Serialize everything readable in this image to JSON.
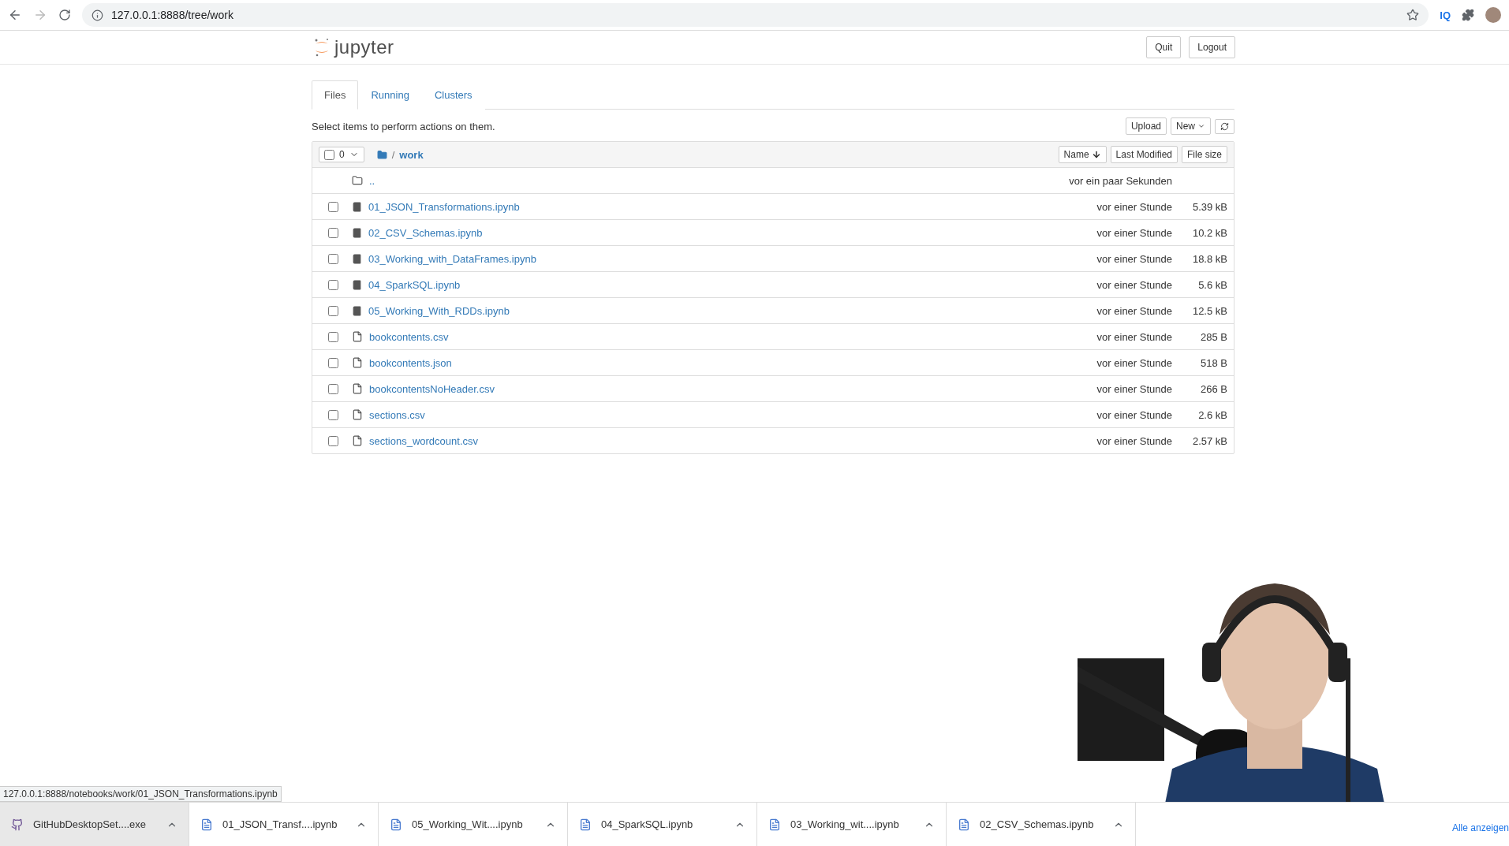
{
  "browser": {
    "url": "127.0.0.1:8888/tree/work",
    "extension": "IQ"
  },
  "header": {
    "logo_text": "jupyter",
    "buttons": [
      "Quit",
      "Logout"
    ]
  },
  "tabs": [
    {
      "label": "Files",
      "selected": true
    },
    {
      "label": "Running",
      "selected": false
    },
    {
      "label": "Clusters",
      "selected": false
    }
  ],
  "toolbar": {
    "hint": "Select items to perform actions on them.",
    "upload": "Upload",
    "new": "New"
  },
  "list_header": {
    "all_checked": false,
    "count": "0",
    "separator": "/",
    "folder": "work",
    "sort_buttons": [
      {
        "label": "Name",
        "sorted": true
      },
      {
        "label": "Last Modified",
        "sorted": false
      },
      {
        "label": "File size",
        "sorted": false
      }
    ]
  },
  "parent_row": {
    "name": "..",
    "modified": "vor ein paar Sekunden"
  },
  "rows": [
    {
      "kind": "notebook",
      "name": "01_JSON_Transformations.ipynb",
      "modified": "vor einer Stunde",
      "size": "5.39 kB",
      "checked": false
    },
    {
      "kind": "notebook",
      "name": "02_CSV_Schemas.ipynb",
      "modified": "vor einer Stunde",
      "size": "10.2 kB",
      "checked": false
    },
    {
      "kind": "notebook",
      "name": "03_Working_with_DataFrames.ipynb",
      "modified": "vor einer Stunde",
      "size": "18.8 kB",
      "checked": false
    },
    {
      "kind": "notebook",
      "name": "04_SparkSQL.ipynb",
      "modified": "vor einer Stunde",
      "size": "5.6 kB",
      "checked": false
    },
    {
      "kind": "notebook",
      "name": "05_Working_With_RDDs.ipynb",
      "modified": "vor einer Stunde",
      "size": "12.5 kB",
      "checked": false
    },
    {
      "kind": "file",
      "name": "bookcontents.csv",
      "modified": "vor einer Stunde",
      "size": "285 B",
      "checked": false
    },
    {
      "kind": "file",
      "name": "bookcontents.json",
      "modified": "vor einer Stunde",
      "size": "518 B",
      "checked": false
    },
    {
      "kind": "file",
      "name": "bookcontentsNoHeader.csv",
      "modified": "vor einer Stunde",
      "size": "266 B",
      "checked": false
    },
    {
      "kind": "file",
      "name": "sections.csv",
      "modified": "vor einer Stunde",
      "size": "2.6 kB",
      "checked": false
    },
    {
      "kind": "file",
      "name": "sections_wordcount.csv",
      "modified": "vor einer Stunde",
      "size": "2.57 kB",
      "checked": false
    }
  ],
  "status_url": "127.0.0.1:8888/notebooks/work/01_JSON_Transformations.ipynb",
  "downloads": [
    {
      "kind": "app",
      "name": "GitHubDesktopSet....exe",
      "highlighted": true
    },
    {
      "kind": "document",
      "name": "01_JSON_Transf....ipynb",
      "highlighted": false
    },
    {
      "kind": "document",
      "name": "05_Working_Wit....ipynb",
      "highlighted": false
    },
    {
      "kind": "document",
      "name": "04_SparkSQL.ipynb",
      "highlighted": false
    },
    {
      "kind": "document",
      "name": "03_Working_wit....ipynb",
      "highlighted": false
    },
    {
      "kind": "document",
      "name": "02_CSV_Schemas.ipynb",
      "highlighted": false
    }
  ],
  "show_all": "Alle anzeigen"
}
